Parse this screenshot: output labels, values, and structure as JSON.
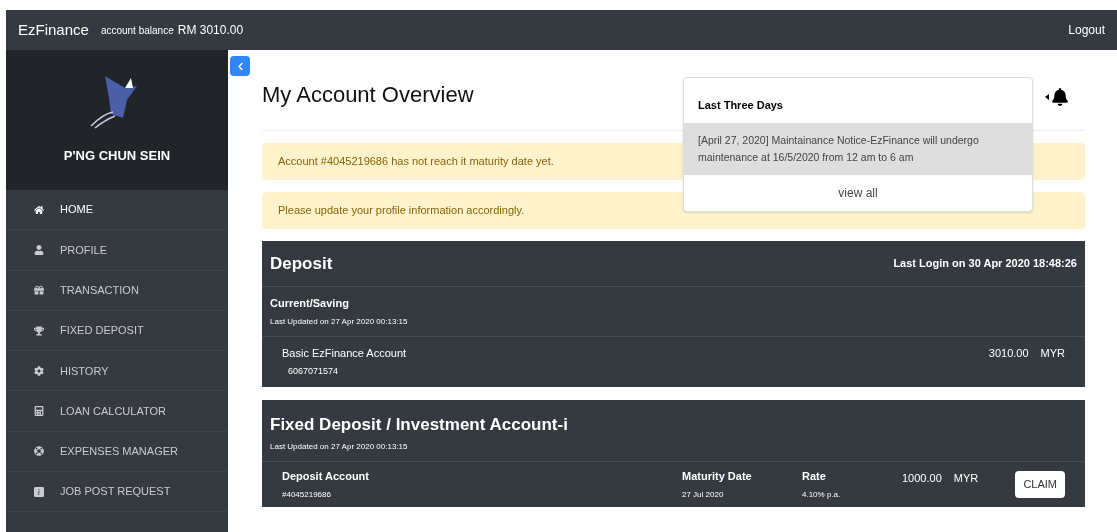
{
  "navbar": {
    "brand": "EzFinance",
    "balance_label": "account balance",
    "balance": "RM 3010.00",
    "logout": "Logout"
  },
  "sidebar": {
    "user_name": "P'NG CHUN SEIN",
    "items": [
      {
        "label": "HOME",
        "selected": true
      },
      {
        "label": "PROFILE",
        "selected": false
      },
      {
        "label": "TRANSACTION",
        "selected": false
      },
      {
        "label": "FIXED DEPOSIT",
        "selected": false
      },
      {
        "label": "HISTORY",
        "selected": false
      },
      {
        "label": "LOAN CALCULATOR",
        "selected": false
      },
      {
        "label": "EXPENSES MANAGER",
        "selected": false
      },
      {
        "label": "JOB POST REQUEST",
        "selected": false
      }
    ]
  },
  "page_title": "My Account Overview",
  "alerts": [
    "Account #4045219686 has not reach it maturity date yet.",
    "Please update your profile information accordingly."
  ],
  "notifications": {
    "heading": "Last Three Days",
    "items": [
      "[April 27, 2020] Maintainance Notice-EzFinance will undergo maintenance at 16/5/2020 from 12 am to 6 am"
    ],
    "view_all": "view all"
  },
  "deposit": {
    "title": "Deposit",
    "last_login": "Last Login on 30 Apr 2020 18:48:26",
    "section_title": "Current/Saving",
    "updated": "Last Updated on 27 Apr 2020 00:13:15",
    "accounts": [
      {
        "name": "Basic EzFinance Account",
        "number": "6067071574",
        "amount": "3010.00",
        "currency": "MYR"
      }
    ]
  },
  "fixed": {
    "title": "Fixed Deposit / Investment Account-i",
    "updated": "Last Updated on 27 Apr 2020 00:13:15",
    "accounts": [
      {
        "name": "Deposit Account",
        "number": "#4045219686",
        "maturity_label": "Maturity Date",
        "maturity": "27 Jul 2020",
        "rate_label": "Rate",
        "rate": "4.10% p.a.",
        "amount": "1000.00",
        "currency": "MYR",
        "action": "CLAIM"
      }
    ]
  }
}
